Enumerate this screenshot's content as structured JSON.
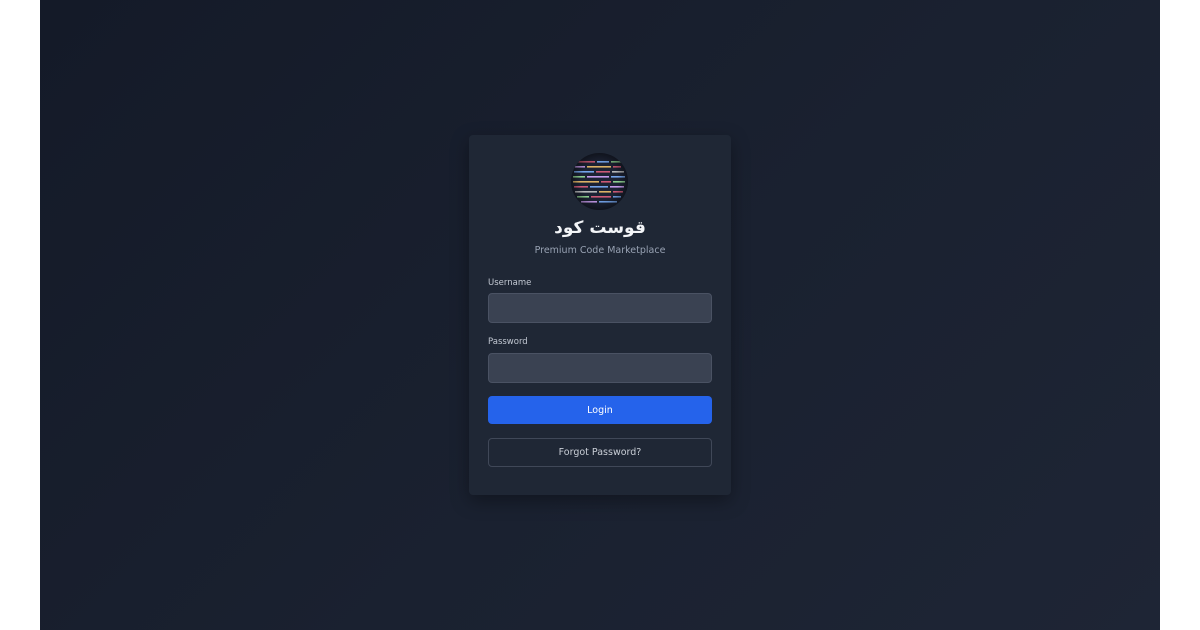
{
  "brand": {
    "title": "قوست كود",
    "subtitle": "Premium Code Marketplace",
    "logo_icon": "code-screen-icon"
  },
  "form": {
    "username": {
      "label": "Username",
      "value": "",
      "placeholder": ""
    },
    "password": {
      "label": "Password",
      "value": "",
      "placeholder": ""
    },
    "login_label": "Login",
    "forgot_label": "Forgot Password?"
  },
  "colors": {
    "background": "#161c2a",
    "card": "#1f2735",
    "input": "#3a4252",
    "accent": "#2563eb"
  }
}
